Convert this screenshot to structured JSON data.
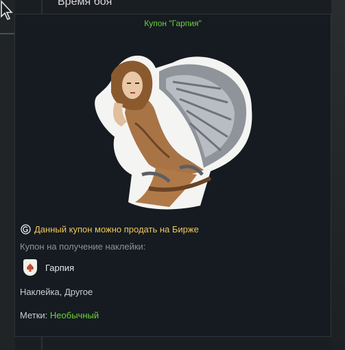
{
  "background": {
    "title": "Время боя"
  },
  "tooltip": {
    "title": "Купон \"Гарпия\"",
    "market_note": "Данный купон можно продать на Бирже",
    "coupon_description": "Купон на получение наклейки:",
    "item_name": "Гарпия",
    "category": "Наклейка, Другое",
    "tags_label": "Метки:",
    "tags_value": "Необычный"
  },
  "colors": {
    "accent_green": "#6fd13a",
    "market_gold": "#f0c75a"
  },
  "icons": {
    "cursor": "cursor-arrow-icon",
    "market": "market-g-icon",
    "item": "spade-shield-icon",
    "sticker": "harpy-sticker-image"
  }
}
